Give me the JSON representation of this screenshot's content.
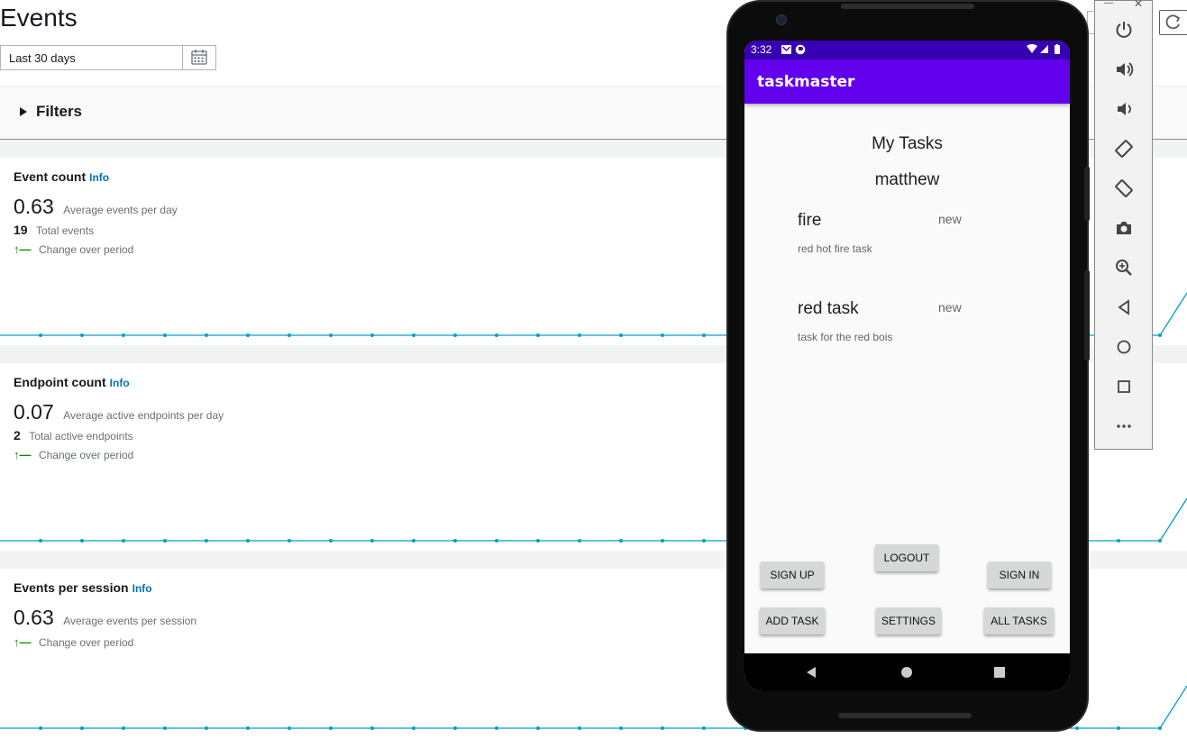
{
  "page": {
    "title": "Events"
  },
  "date_range": {
    "value": "Last 30 days",
    "calendar_icon": "calendar-icon"
  },
  "filters": {
    "label": "Filters"
  },
  "cards": {
    "event_count": {
      "title": "Event count",
      "info": "Info",
      "big": "0.63",
      "big_label": "Average events per day",
      "total": "19",
      "total_label": "Total events",
      "change_label": "Change over period"
    },
    "endpoint_count": {
      "title": "Endpoint count",
      "info": "Info",
      "big": "0.07",
      "big_label": "Average active endpoints per day",
      "total": "2",
      "total_label": "Total active endpoints",
      "change_label": "Change over period"
    },
    "events_per_session": {
      "title": "Events per session",
      "info": "Info",
      "big": "0.63",
      "big_label": "Average events per session",
      "change_label": "Change over period"
    }
  },
  "emulator_panel": {
    "tools": [
      "power-icon",
      "volume-up-icon",
      "volume-down-icon",
      "rotate-left-icon",
      "rotate-right-icon",
      "camera-icon",
      "zoom-icon",
      "back-icon",
      "home-icon",
      "overview-icon",
      "more-icon"
    ]
  },
  "phone": {
    "status": {
      "time": "3:32"
    },
    "app": {
      "title": "taskmaster",
      "heading": "My Tasks",
      "username": "matthew"
    },
    "tasks": [
      {
        "title": "fire",
        "state": "new",
        "body": "red hot fire task"
      },
      {
        "title": "red task",
        "state": "new",
        "body": "task for the red bois"
      }
    ],
    "buttons": {
      "sign_up": "SIGN UP",
      "logout": "LOGOUT",
      "sign_in": "SIGN IN",
      "add_task": "ADD TASK",
      "settings": "SETTINGS",
      "all_tasks": "ALL TASKS"
    }
  },
  "colors": {
    "accent": "#6200ee",
    "status_bar": "#3700b3",
    "info_link": "#0073bb",
    "chart_line": "#00a1c9",
    "change_up": "#1d8102"
  }
}
